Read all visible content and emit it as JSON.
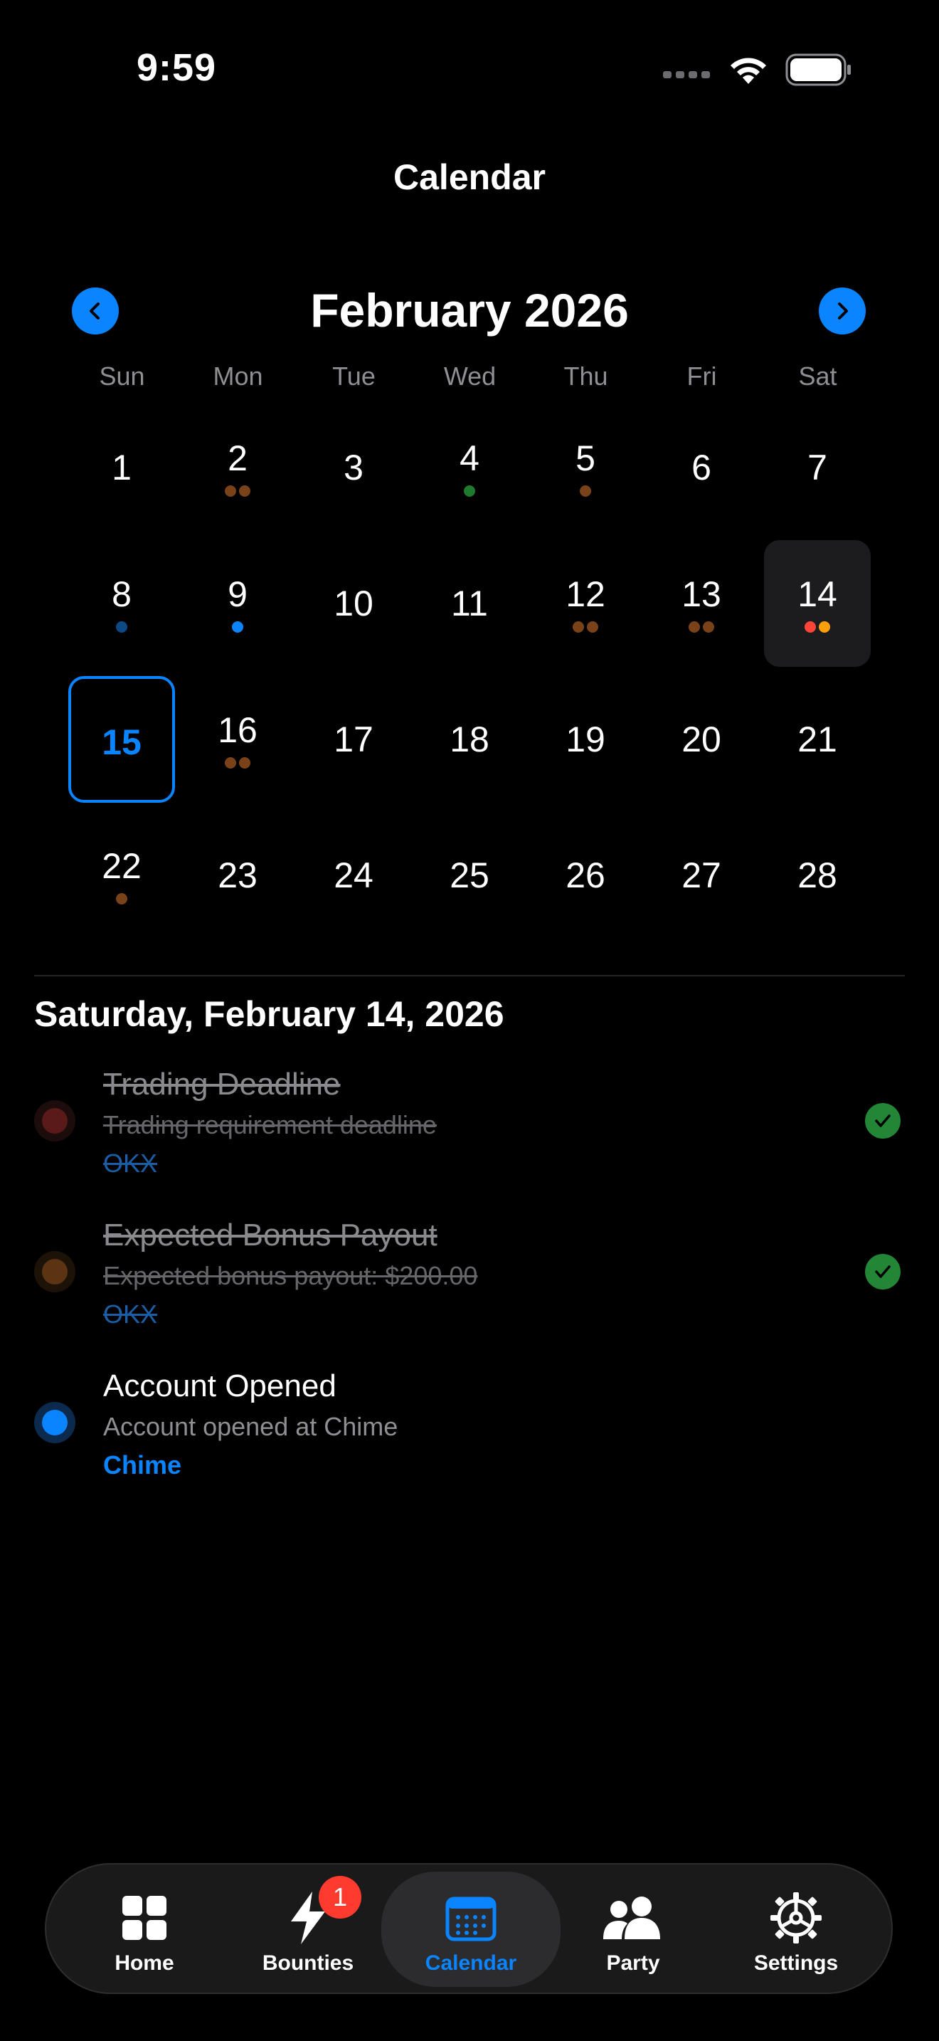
{
  "status_bar": {
    "time": "9:59"
  },
  "header": {
    "title": "Calendar"
  },
  "calendar": {
    "month_label": "February 2026",
    "weekdays": [
      "Sun",
      "Mon",
      "Tue",
      "Wed",
      "Thu",
      "Fri",
      "Sat"
    ],
    "weeks": [
      [
        {
          "day": "1",
          "dots": []
        },
        {
          "day": "2",
          "dots": [
            "#7a4218",
            "#7a4218"
          ]
        },
        {
          "day": "3",
          "dots": []
        },
        {
          "day": "4",
          "dots": [
            "#1e7a2e"
          ]
        },
        {
          "day": "5",
          "dots": [
            "#7a4218"
          ]
        },
        {
          "day": "6",
          "dots": []
        },
        {
          "day": "7",
          "dots": []
        }
      ],
      [
        {
          "day": "8",
          "dots": [
            "#0d4a85"
          ]
        },
        {
          "day": "9",
          "dots": [
            "#0a84ff"
          ]
        },
        {
          "day": "10",
          "dots": []
        },
        {
          "day": "11",
          "dots": []
        },
        {
          "day": "12",
          "dots": [
            "#7a4218",
            "#7a4218"
          ]
        },
        {
          "day": "13",
          "dots": [
            "#7a4218",
            "#7a4218"
          ]
        },
        {
          "day": "14",
          "dots": [
            "#ff453a",
            "#ff9f0a"
          ],
          "selected": true
        }
      ],
      [
        {
          "day": "15",
          "dots": [],
          "today": true
        },
        {
          "day": "16",
          "dots": [
            "#7a4218",
            "#7a4218"
          ]
        },
        {
          "day": "17",
          "dots": []
        },
        {
          "day": "18",
          "dots": []
        },
        {
          "day": "19",
          "dots": []
        },
        {
          "day": "20",
          "dots": []
        },
        {
          "day": "21",
          "dots": []
        }
      ],
      [
        {
          "day": "22",
          "dots": [
            "#7a4218"
          ]
        },
        {
          "day": "23",
          "dots": []
        },
        {
          "day": "24",
          "dots": []
        },
        {
          "day": "25",
          "dots": []
        },
        {
          "day": "26",
          "dots": []
        },
        {
          "day": "27",
          "dots": []
        },
        {
          "day": "28",
          "dots": []
        }
      ]
    ]
  },
  "selected_date_label": "Saturday, February 14, 2026",
  "events": [
    {
      "title": "Trading Deadline",
      "description": "Trading requirement deadline",
      "source": "OKX",
      "completed": true,
      "dot_color": "#5a1a1a",
      "ring_color": "#1c0c0c"
    },
    {
      "title": "Expected Bonus Payout",
      "description": "Expected bonus payout: $200.00",
      "source": "OKX",
      "completed": true,
      "dot_color": "#5c3413",
      "ring_color": "#1c1208"
    },
    {
      "title": "Account Opened",
      "description": "Account opened at Chime",
      "source": "Chime",
      "completed": false,
      "dot_color": "#0a84ff",
      "ring_color": "#0b2a4d"
    }
  ],
  "tabbar": {
    "tabs": [
      {
        "label": "Home",
        "icon": "home-grid-icon"
      },
      {
        "label": "Bounties",
        "icon": "lightning-icon",
        "badge": "1"
      },
      {
        "label": "Calendar",
        "icon": "calendar-icon",
        "active": true
      },
      {
        "label": "Party",
        "icon": "people-icon"
      },
      {
        "label": "Settings",
        "icon": "gear-icon"
      }
    ]
  },
  "colors": {
    "accent": "#0a84ff",
    "background": "#000000",
    "check_green": "#238636",
    "badge_red": "#ff3b30"
  }
}
